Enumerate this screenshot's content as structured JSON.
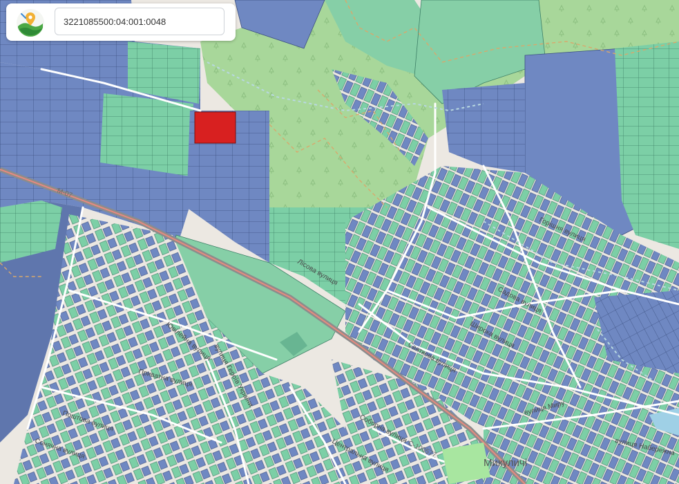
{
  "search": {
    "value": "3221085500:04:001:0048",
    "placeholder": ""
  },
  "app": {
    "logo_icon": "map-pin-logo-icon"
  },
  "map": {
    "place_label": "Микуличі",
    "road_labels": [
      "М-07",
      "С-100577"
    ],
    "street_labels": [
      "вулиця Миру",
      "Садова вулиця",
      "Широка вулиця",
      "Соборна вулиця",
      "Святкова вулиця",
      "Центральна вулиця",
      "Приватна вулиця",
      "вулиця Героїв України",
      "вулиця Набережна",
      "Поштова вулиця",
      "Горішня вулиця",
      "Сонячна вулиця",
      "Лісова вулиця",
      "Ювілейна вулиця"
    ],
    "colors": {
      "selected_parcel": "#d82020",
      "parcel_green": "#7ccfa6",
      "parcel_blue": "#6f88c2",
      "forest": "#a8d79a",
      "background": "#ece8e2"
    }
  }
}
